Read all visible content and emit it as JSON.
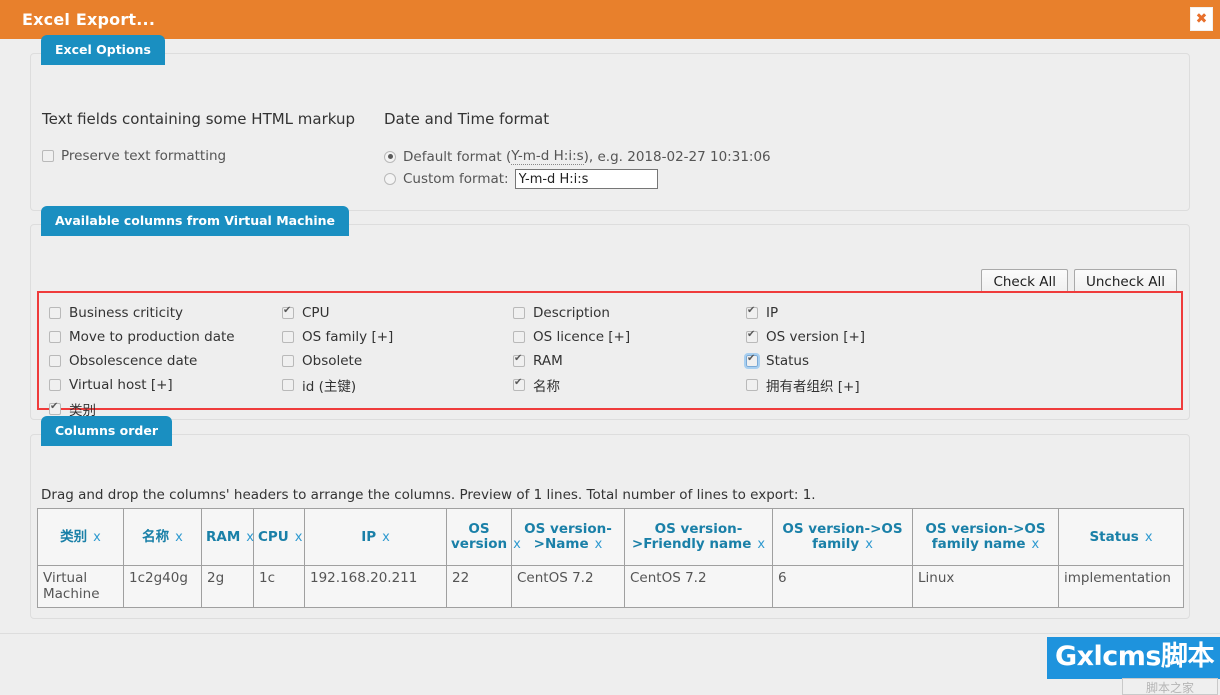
{
  "window": {
    "title": "Excel Export...",
    "close_label": "✖"
  },
  "colors": {
    "titlebar": "#e8802c",
    "legend_tab": "#1a8fc1",
    "highlight_border": "#ef3b3b",
    "table_header_text": "#1a80a8",
    "watermark_bg": "#1e93dd"
  },
  "excel_options": {
    "legend": "Excel Options",
    "left": {
      "heading": "Text fields containing some HTML markup",
      "checkbox": {
        "label": "Preserve text formatting",
        "checked": false
      }
    },
    "right": {
      "heading": "Date and Time format",
      "radios": [
        {
          "label_before": "Default format (",
          "code": "Y-m-d H:i:s",
          "label_after": "), e.g. 2018-02-27 10:31:06",
          "selected": true
        },
        {
          "label": "Custom format:",
          "selected": false
        }
      ],
      "custom_format_value": "Y-m-d H:i:s"
    }
  },
  "available_columns": {
    "legend": "Available columns from Virtual Machine",
    "check_all_label": "Check All",
    "uncheck_all_label": "Uncheck All",
    "columns": [
      [
        {
          "label": "Business criticity",
          "checked": false,
          "focused": false
        },
        {
          "label": "Move to production date",
          "checked": false,
          "focused": false
        },
        {
          "label": "Obsolescence date",
          "checked": false,
          "focused": false
        },
        {
          "label": "Virtual host [+]",
          "checked": false,
          "focused": false
        },
        {
          "label": "类别",
          "checked": true,
          "focused": false
        }
      ],
      [
        {
          "label": "CPU",
          "checked": true,
          "focused": false
        },
        {
          "label": "OS family [+]",
          "checked": false,
          "focused": false
        },
        {
          "label": "Obsolete",
          "checked": false,
          "focused": false
        },
        {
          "label": "id (主键)",
          "checked": false,
          "focused": false
        }
      ],
      [
        {
          "label": "Description",
          "checked": false,
          "focused": false
        },
        {
          "label": "OS licence [+]",
          "checked": false,
          "focused": false
        },
        {
          "label": "RAM",
          "checked": true,
          "focused": false
        },
        {
          "label": "名称",
          "checked": true,
          "focused": false
        }
      ],
      [
        {
          "label": "IP",
          "checked": true,
          "focused": false
        },
        {
          "label": "OS version [+]",
          "checked": true,
          "focused": false
        },
        {
          "label": "Status",
          "checked": true,
          "focused": true
        },
        {
          "label": "拥有者组织 [+]",
          "checked": false,
          "focused": false
        }
      ]
    ]
  },
  "columns_order": {
    "legend": "Columns order",
    "description": "Drag and drop the columns' headers to arrange the columns. Preview of 1 lines. Total number of lines to export: 1.",
    "remove_glyph": "x",
    "headers": [
      "类别",
      "名称",
      "RAM",
      "CPU",
      "IP",
      "OS version",
      "OS version->Name",
      "OS version->Friendly name",
      "OS version->OS family",
      "OS version->OS family name",
      "Status"
    ],
    "rows": [
      [
        "Virtual Machine",
        "1c2g40g",
        "2g",
        "1c",
        "192.168.20.211",
        "22",
        "CentOS 7.2",
        "CentOS 7.2",
        "6",
        "Linux",
        "implementation"
      ]
    ]
  },
  "watermark": {
    "text": "Gxlcms脚本",
    "ghost_text": "脚本之家"
  }
}
